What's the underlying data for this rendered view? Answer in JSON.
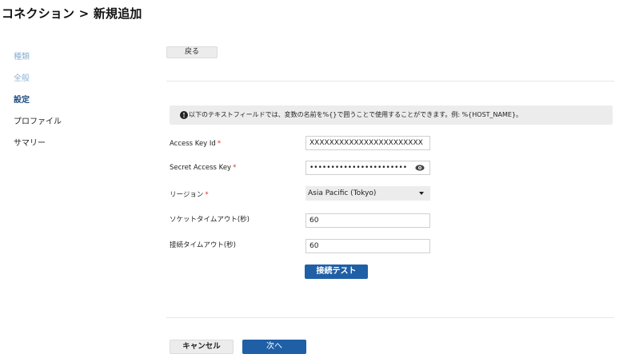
{
  "header": {
    "title": "コネクション > 新規追加"
  },
  "sidebar": {
    "items": [
      {
        "label": "種類"
      },
      {
        "label": "全般"
      },
      {
        "label": "設定"
      },
      {
        "label": "プロファイル"
      },
      {
        "label": "サマリー"
      }
    ]
  },
  "toolbar": {
    "back_label": "戻る"
  },
  "info": {
    "icon": "info-icon",
    "text": "以下のテキストフィールドでは、変数の名前を%{}で囲うことで使用することができます。例: %{HOST_NAME}。"
  },
  "form": {
    "access_key_id": {
      "label": "Access Key Id",
      "required": "*",
      "value": "XXXXXXXXXXXXXXXXXXXXXXX"
    },
    "secret_access_key": {
      "label": "Secret Access Key",
      "required": "*",
      "value": "•••••••••••••••••••••••"
    },
    "region": {
      "label": "リージョン",
      "required": "*",
      "value": "Asia Pacific (Tokyo)"
    },
    "socket_timeout": {
      "label": "ソケットタイムアウト(秒)",
      "value": "60"
    },
    "connect_timeout": {
      "label": "接続タイムアウト(秒)",
      "value": "60"
    },
    "test_button": "接続テスト"
  },
  "footer": {
    "cancel_label": "キャンセル",
    "next_label": "次へ"
  },
  "colors": {
    "primary": "#1f5fa6",
    "muted_link": "#8db2d4",
    "active": "#1c4b82",
    "required": "#dd3333"
  }
}
